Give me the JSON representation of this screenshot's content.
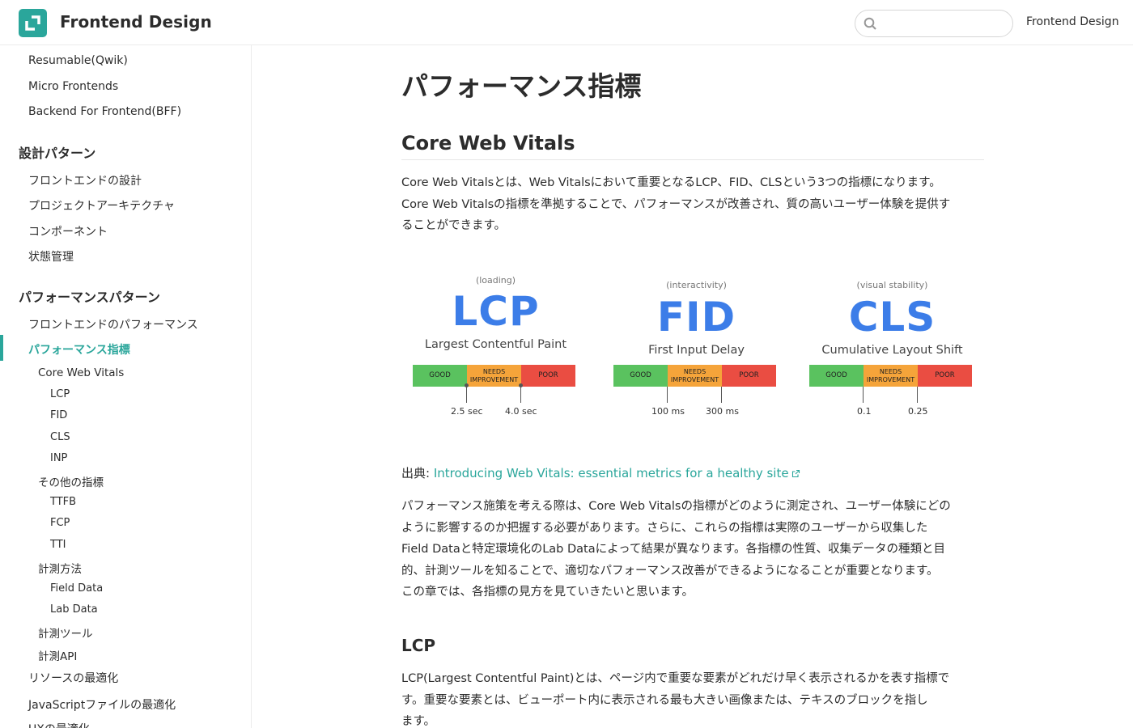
{
  "header": {
    "brand": "Frontend Design",
    "search_placeholder": "",
    "nav_link": "Frontend Design"
  },
  "sidebar": {
    "top_items": [
      "Resumable(Qwik)",
      "Micro Frontends",
      "Backend For Frontend(BFF)"
    ],
    "section_design": "設計パターン",
    "design_items": [
      "フロントエンドの設計",
      "プロジェクトアーキテクチャ",
      "コンポーネント",
      "状態管理"
    ],
    "section_perf": "パフォーマンスパターン",
    "perf_item1": "フロントエンドのパフォーマンス",
    "perf_active": "パフォーマンス指標",
    "cwv": "Core Web Vitals",
    "cwv_items": [
      "LCP",
      "FID",
      "CLS",
      "INP"
    ],
    "other": "その他の指標",
    "other_items": [
      "TTFB",
      "FCP",
      "TTI"
    ],
    "method": "計測方法",
    "method_items": [
      "Field Data",
      "Lab Data"
    ],
    "tools": "計測ツール",
    "api": "計測API",
    "resource": "リソースの最適化",
    "js": "JavaScriptファイルの最適化",
    "ux": "UXの最適化"
  },
  "main": {
    "title": "パフォーマンス指標",
    "h2": "Core Web Vitals",
    "intro_lines": [
      "Core Web Vitalsとは、Web Vitalsにおいて重要となるLCP、FID、CLSという3つの指標になります。",
      "Core Web Vitalsの指標を準拠することで、パフォーマンスが改善され、質の高いユーザー体験を提供す",
      "ることができます。"
    ],
    "source_prefix": "出典: ",
    "source_link": "Introducing Web Vitals: essential metrics for a healthy site",
    "body_lines": [
      "パフォーマンス施策を考える際は、Core Web Vitalsの指標がどのように測定され、ユーザー体験にどの",
      "ように影響するのか把握する必要があります。さらに、これらの指標は実際のユーザーから収集した",
      "Field Dataと特定環境化のLab Dataによって結果が異なります。各指標の性質、収集データの種類と目",
      "的、計測ツールを知ることで、適切なパフォーマンス改善ができるようになることが重要となります。",
      "この章では、各指標の見方を見ていきたいと思います。"
    ],
    "h3": "LCP",
    "lcp_lines": [
      "LCP(Largest Contentful Paint)とは、ページ内で重要な要素がどれだけ早く表示されるかを表す指標で",
      "す。重要な要素とは、ビューポート内に表示される最も大きい画像または、テキスのブロックを指し",
      "ます。"
    ]
  },
  "vitals": {
    "segments": {
      "good": "GOOD",
      "needs1": "NEEDS",
      "needs2": "IMPROVEMENT",
      "poor": "POOR"
    },
    "colors": {
      "good": "#5ac25f",
      "needs": "#f5a43a",
      "poor": "#ea4d42",
      "accent": "#3c7de8"
    },
    "metrics": [
      {
        "category": "(loading)",
        "abbr": "LCP",
        "name": "Largest Contentful Paint",
        "t1": "2.5 sec",
        "t2": "4.0 sec"
      },
      {
        "category": "(interactivity)",
        "abbr": "FID",
        "name": "First Input Delay",
        "t1": "100 ms",
        "t2": "300 ms"
      },
      {
        "category": "(visual stability)",
        "abbr": "CLS",
        "name": "Cumulative Layout Shift",
        "t1": "0.1",
        "t2": "0.25"
      }
    ]
  }
}
